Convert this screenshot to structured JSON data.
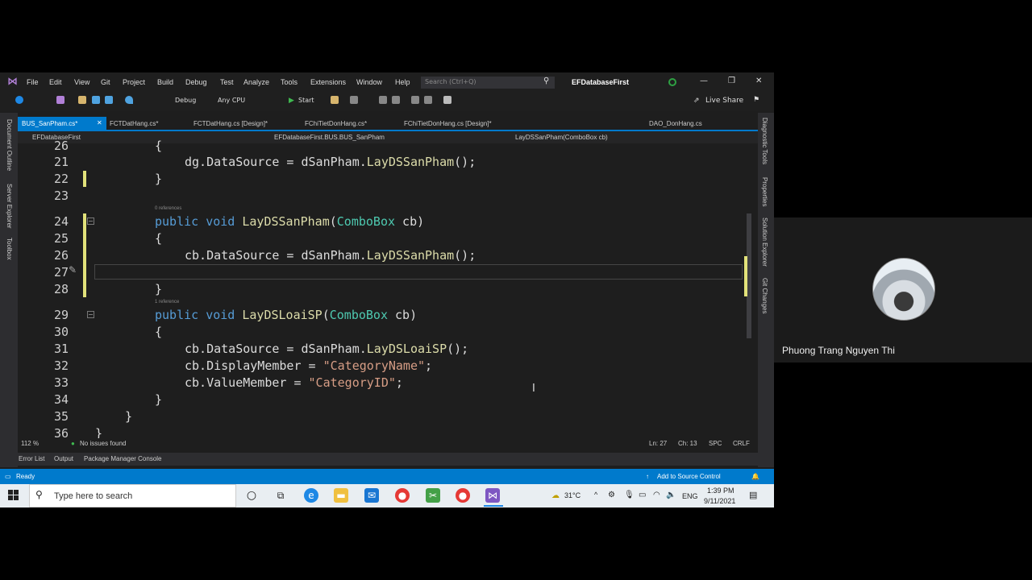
{
  "call": {
    "participant_name": "Phuong Trang Nguyen Thi"
  },
  "titlebar": {
    "menus": [
      "File",
      "Edit",
      "View",
      "Git",
      "Project",
      "Build",
      "Debug",
      "Test",
      "Analyze",
      "Tools",
      "Extensions",
      "Window",
      "Help"
    ],
    "search_placeholder": "Search (Ctrl+Q)",
    "solution": "EFDatabaseFirst"
  },
  "toolbar": {
    "config": "Debug",
    "platform": "Any CPU",
    "start": "Start",
    "live_share": "Live Share"
  },
  "tabs": [
    "BUS_SanPham.cs*",
    "FCTDatHang.cs*",
    "FCTDatHang.cs [Design]*",
    "FChiTietDonHang.cs*",
    "FChiTietDonHang.cs [Design]*",
    "DAO_DonHang.cs"
  ],
  "navbar": {
    "project": "EFDatabaseFirst",
    "class": "EFDatabaseFirst.BUS.BUS_SanPham",
    "member": "LayDSSanPham(ComboBox cb)"
  },
  "left_panels": [
    "Document Outline",
    "Server Explorer",
    "Toolbox"
  ],
  "right_panels": [
    "Diagnostic Tools",
    "Properties",
    "Solution Explorer",
    "Git Changes"
  ],
  "lines": [
    "26",
    "21",
    "22",
    "23",
    "24",
    "25",
    "26",
    "27",
    "28",
    "29",
    "30",
    "31",
    "32",
    "33",
    "34",
    "35",
    "36"
  ],
  "code": {
    "l21_obj": "dg.DataSource = dSanPham.",
    "l21_fn": "LayDSSanPham",
    "paren": "();",
    "refs0": "0 references",
    "refs1": "1 reference",
    "kw_public": "public",
    "kw_void": "void",
    "fn_sp": "LayDSSanPham",
    "fn_loai": "LayDSLoaiSP",
    "type_cb": "ComboBox",
    "param": " cb)",
    "open_paren": "(",
    "l26_obj": "cb.DataSource = dSanPham.",
    "l31_fn": "LayDSLoaiSP",
    "l32_left": "cb.DisplayMember = ",
    "l32_str": "\"CategoryName\"",
    "l33_left": "cb.ValueMember = ",
    "l33_str": "\"CategoryID\"",
    "semi": ";",
    "brace_open": "{",
    "brace_close": "}"
  },
  "statusline": {
    "zoom": "112 %",
    "issues": "No issues found",
    "ln": "Ln: 27",
    "ch": "Ch: 13",
    "spc": "SPC",
    "crlf": "CRLF"
  },
  "bottom_tabs": [
    "Error List",
    "Output",
    "Package Manager Console"
  ],
  "vs_status": {
    "ready": "Ready",
    "source_control": "Add to Source Control"
  },
  "taskbar": {
    "search": "Type here to search",
    "temp": "31°C",
    "lang": "ENG",
    "time": "1:39 PM",
    "date": "9/11/2021"
  }
}
